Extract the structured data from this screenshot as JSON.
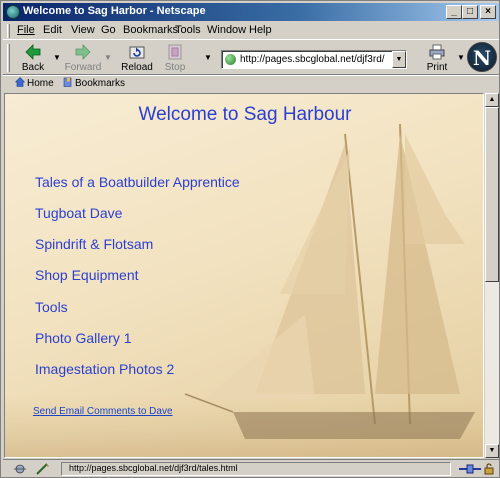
{
  "window": {
    "title": "Welcome to Sag Harbor - Netscape",
    "controls": {
      "minimize": "_",
      "maximize": "□",
      "close": "×"
    }
  },
  "menubar": {
    "items": [
      {
        "label": "File",
        "accesskey": "F"
      },
      {
        "label": "Edit",
        "accesskey": "E"
      },
      {
        "label": "View",
        "accesskey": "V"
      },
      {
        "label": "Go",
        "accesskey": "G"
      },
      {
        "label": "Bookmarks",
        "accesskey": "B"
      },
      {
        "label": "Tools",
        "accesskey": "T"
      },
      {
        "label": "Window",
        "accesskey": "W"
      },
      {
        "label": "Help",
        "accesskey": "H"
      }
    ]
  },
  "toolbar": {
    "back_label": "Back",
    "forward_label": "Forward",
    "reload_label": "Reload",
    "stop_label": "Stop",
    "print_label": "Print",
    "url": "http://pages.sbcglobal.net/djf3rd/",
    "logo_letter": "N"
  },
  "personal_toolbar": {
    "home_label": "Home",
    "bookmarks_label": "Bookmarks"
  },
  "page": {
    "heading": "Welcome to Sag Harbour",
    "links": [
      "Tales of a Boatbuilder Apprentice",
      "Tugboat Dave",
      "Spindrift & Flotsam",
      "Shop Equipment",
      "Tools",
      "Photo Gallery 1",
      "Imagestation Photos 2"
    ],
    "email_link": "Send Email Comments to Dave"
  },
  "statusbar": {
    "text": "http://pages.sbcglobal.net/djf3rd/tales.html"
  },
  "colors": {
    "link": "#2b3fd1",
    "titlebar_start": "#0a246a",
    "chrome": "#d4d0c8",
    "page_bg": "#f2e2c0"
  }
}
